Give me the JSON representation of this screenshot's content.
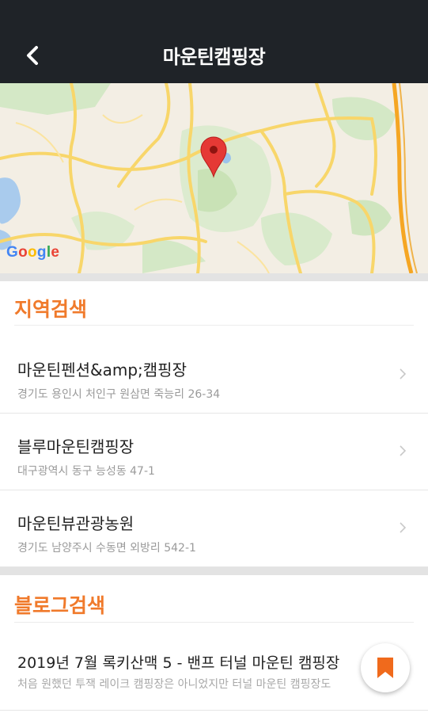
{
  "header": {
    "title": "마운틴캠핑장",
    "back_icon": "back-arrow-icon"
  },
  "map": {
    "brand": "Google",
    "marker_icon": "map-pin-icon"
  },
  "region_search": {
    "title": "지역검색",
    "items": [
      {
        "name": "마운틴펜션&amp;캠핑장",
        "address": "경기도 용인시 처인구 원삼면 죽능리 26-34"
      },
      {
        "name": "블루마운틴캠핑장",
        "address": "대구광역시 동구 능성동 47-1"
      },
      {
        "name": "마운틴뷰관광농원",
        "address": "경기도 남양주시 수동면 외방리 542-1"
      }
    ]
  },
  "blog_search": {
    "title": "블로그검색",
    "items": [
      {
        "title": "2019년 7월 록키산맥 5 - 밴프 터널 마운틴 캠핑장",
        "snippet": "처음 원했던 투잭 레이크 캠핑장은 아니었지만 터널 마운틴 캠핑장도"
      }
    ]
  },
  "fab": {
    "icon": "bookmark-icon"
  },
  "colors": {
    "accent": "#f07a2b",
    "appbar": "#1f2328",
    "bookmark": "#f06a1c",
    "marker": "#e53935"
  }
}
